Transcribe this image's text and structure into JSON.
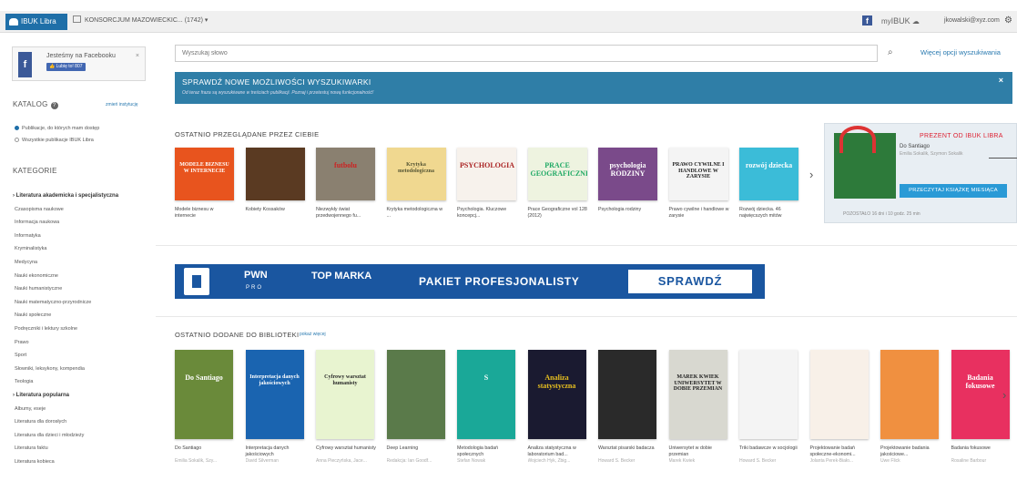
{
  "topbar": {
    "logo": "IBUK Libra",
    "consortium": "KONSORCJUM MAZOWIECKIC...",
    "count": "(1742) ▾",
    "fb_icon": "f",
    "my_ibuk_prefix": "my",
    "my_ibuk": "IBUK",
    "user": "jkowalski@xyz.com",
    "settings_icon": "⚙"
  },
  "sidebar": {
    "facebook": {
      "text": "Jesteśmy na Facebooku",
      "like": "👍 Lubię to! 807",
      "close": "×"
    },
    "katalog": "KATALOG",
    "katalog_help": "?",
    "zmien": "zmień instytucję",
    "radio1": "Publikacje, do których mam dostęp",
    "radio2": "Wszystkie publikacje IBUK Libra",
    "kategorie": "KATEGORIE",
    "categories": [
      {
        "label": "› Literatura akademicka i specjalistyczna",
        "head": true
      },
      {
        "label": "Czasopisma naukowe"
      },
      {
        "label": "Informacja naukowa"
      },
      {
        "label": "Informatyka"
      },
      {
        "label": "Kryminalistyka"
      },
      {
        "label": "Medycyna"
      },
      {
        "label": "Nauki ekonomiczne"
      },
      {
        "label": "Nauki humanistyczne"
      },
      {
        "label": "Nauki matematyczno-przyrodnicze"
      },
      {
        "label": "Nauki społeczne"
      },
      {
        "label": "Podręczniki i lektury szkolne"
      },
      {
        "label": "Prawo"
      },
      {
        "label": "Sport"
      },
      {
        "label": "Słowniki, leksykony, kompendia"
      },
      {
        "label": "Teologia"
      },
      {
        "label": "› Literatura popularna",
        "head": true
      },
      {
        "label": "Albumy, eseje"
      },
      {
        "label": "Literatura dla dorosłych"
      },
      {
        "label": "Literatura dla dzieci i młodzieży"
      },
      {
        "label": "Literatura faktu"
      },
      {
        "label": "Literatura kobieca"
      }
    ]
  },
  "main": {
    "search": {
      "placeholder": "Wyszukaj słowo",
      "icon": "⌕",
      "advanced": "Więcej opcji wyszukiwania"
    },
    "banner": {
      "title": "SPRAWDŹ NOWE MOŻLIWOŚCI WYSZUKIWARKI",
      "text": "Od teraz fraza są wyszukiwane w treściach publikacji. Poznaj i przetestuj nową funkcjonalność!",
      "close": "×"
    },
    "recent_title": "OSTATNIO PRZEGLĄDANE PRZEZ CIEBIE",
    "recent": [
      {
        "title": "Modele biznesu w internecie",
        "cover": "MODELE BIZNESU W INTERNECIE",
        "bg": "#e8541e",
        "fg": "#fff"
      },
      {
        "title": "Kobiety Kossaków",
        "cover": "",
        "bg": "#5a3a22",
        "fg": "#fff"
      },
      {
        "title": "Niezwykły świat przedwojennego fu...",
        "cover": "futbolu",
        "bg": "#8a8070",
        "fg": "#c22"
      },
      {
        "title": "Krytyka metodologiczna w ...",
        "cover": "Krytyka metodologiczna",
        "bg": "#f0d890",
        "fg": "#553"
      },
      {
        "title": "Psychologia. Kluczowe koncepcj...",
        "cover": "PSYCHOLOGIA",
        "bg": "#f7f2ec",
        "fg": "#a22"
      },
      {
        "title": "Prace Geograficzne vol 128 (2012)",
        "cover": "PRACE GEOGRAFICZNE",
        "bg": "#eef3e0",
        "fg": "#2a6"
      },
      {
        "title": "Psychologia rodziny",
        "cover": "psychologia RODZINY",
        "bg": "#7a4a8a",
        "fg": "#fff"
      },
      {
        "title": "Prawo cywilne i handlowe w zarysie",
        "cover": "PRAWO CYWILNE I HANDLOWE W ZARYSIE",
        "bg": "#f4f4f4",
        "fg": "#222"
      },
      {
        "title": "Rozwój dziecka. 46 najwięcszych mitów",
        "cover": "rozwój dziecka",
        "bg": "#3bbcd8",
        "fg": "#fff"
      }
    ],
    "gift": {
      "header": "PREZENT OD IBUK LIBRA",
      "book": "Do Santiago",
      "authors": "Emilia Sokalik, Szymon Sokalik",
      "button": "PRZECZYTAJ KSIĄŻKĘ MIESIĄCA",
      "countdown": "POZOSTAŁO 16 dni i 10 godz. 25 min"
    },
    "ad": {
      "pwn": "PWN",
      "pro": "PRO",
      "top": "TOP MARKA",
      "pakiet": "PAKIET PROFESJONALISTY",
      "button": "SPRAWDŹ"
    },
    "added_title": "OSTATNIO DODANE DO BIBLIOTEKI",
    "added_more": "pokaż więcej",
    "added": [
      {
        "title": "Do Santiago",
        "author": "Emilia Sokalik, Szy...",
        "cover": "Do Santiago",
        "bg": "#6a8a3a",
        "fg": "#fff"
      },
      {
        "title": "Interpretacja danych jakościowych",
        "author": "David Silverman",
        "cover": "Interpretacja danych jakościowych",
        "bg": "#1a64b0",
        "fg": "#fff"
      },
      {
        "title": "Cyfrowy warsztat humanisty",
        "author": "Anna Pieczyńska, Jace...",
        "cover": "Cyfrowy warsztat humanisty",
        "bg": "#e8f4d0",
        "fg": "#2a2a2a"
      },
      {
        "title": "Deep Learning",
        "author": "Redakcja: Ian Goodf...",
        "cover": "",
        "bg": "#5a7a4a",
        "fg": "#fff"
      },
      {
        "title": "Metodologia badań społecznych",
        "author": "Stefan Nowak",
        "cover": "S",
        "bg": "#1aa898",
        "fg": "#fff"
      },
      {
        "title": "Analiza statystyczna w laboratorium bad...",
        "author": "Wojciech Hyk, Zbig...",
        "cover": "Analiza statystyczna",
        "bg": "#1a1a30",
        "fg": "#e8c020"
      },
      {
        "title": "Warsztat pisarski badacza",
        "author": "Howard S. Becker",
        "cover": "",
        "bg": "#2a2a2a",
        "fg": "#fff"
      },
      {
        "title": "Uniwersytet w dobie przemian",
        "author": "Marek Kwiek",
        "cover": "MAREK KWIEK UNIWERSYTET W DOBIE PRZEMIAN",
        "bg": "#d8d8d0",
        "fg": "#222"
      },
      {
        "title": "Triki badawcze w socjologii",
        "author": "Howard S. Becker",
        "cover": "",
        "bg": "#f4f4f4",
        "fg": "#222"
      },
      {
        "title": "Projektowanie badań społeczne-ekonomi...",
        "author": "Jolanta Perek-Biało...",
        "cover": "",
        "bg": "#f8f0e8",
        "fg": "#222"
      },
      {
        "title": "Projektowanie badania jakościowe...",
        "author": "Uwe Flick",
        "cover": "",
        "bg": "#f09040",
        "fg": "#fff"
      },
      {
        "title": "Badania fokusowe",
        "author": "Rosaline Barbour",
        "cover": "Badania fokusowe",
        "bg": "#e83060",
        "fg": "#fff"
      }
    ]
  }
}
